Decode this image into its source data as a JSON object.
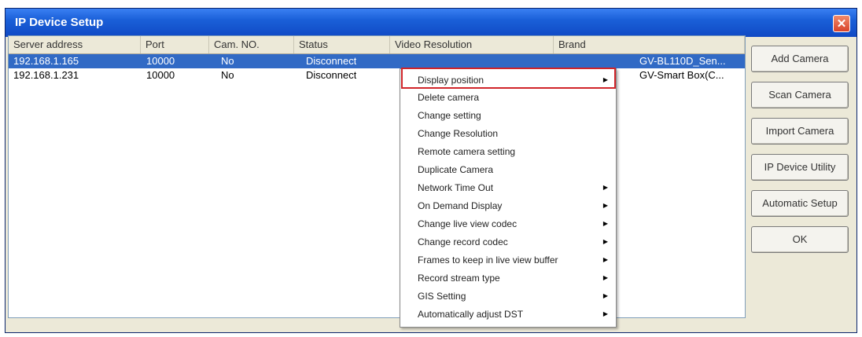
{
  "window": {
    "title": "IP Device Setup",
    "close_icon": "close-icon"
  },
  "columns": [
    "Server address",
    "Port",
    "Cam. NO.",
    "Status",
    "Video Resolution",
    "Brand"
  ],
  "rows": [
    {
      "address": "192.168.1.165",
      "port": "10000",
      "cam_no": "No",
      "status": "Disconnect",
      "brand": "GV-BL110D_Sen..."
    },
    {
      "address": "192.168.1.231",
      "port": "10000",
      "cam_no": "No",
      "status": "Disconnect",
      "brand": "GV-Smart Box(C..."
    }
  ],
  "buttons": [
    "Add Camera",
    "Scan Camera",
    "Import Camera",
    "IP Device Utility",
    "Automatic Setup",
    "OK"
  ],
  "context_menu": [
    {
      "label": "Display position",
      "submenu": true
    },
    {
      "label": "Delete camera",
      "submenu": false
    },
    {
      "label": "Change setting",
      "submenu": false
    },
    {
      "label": "Change Resolution",
      "submenu": false
    },
    {
      "label": "Remote camera setting",
      "submenu": false
    },
    {
      "label": "Duplicate Camera",
      "submenu": false
    },
    {
      "label": "Network Time Out",
      "submenu": true
    },
    {
      "label": "On Demand Display",
      "submenu": true
    },
    {
      "label": "Change live view codec",
      "submenu": true
    },
    {
      "label": "Change record codec",
      "submenu": true
    },
    {
      "label": "Frames to keep in live view buffer",
      "submenu": true
    },
    {
      "label": "Record stream type",
      "submenu": true
    },
    {
      "label": "GIS Setting",
      "submenu": true
    },
    {
      "label": "Automatically adjust DST",
      "submenu": true
    }
  ],
  "colors": {
    "titlebar": "#1a5fd8",
    "selection": "#316ac5",
    "highlight": "#d0252a"
  }
}
